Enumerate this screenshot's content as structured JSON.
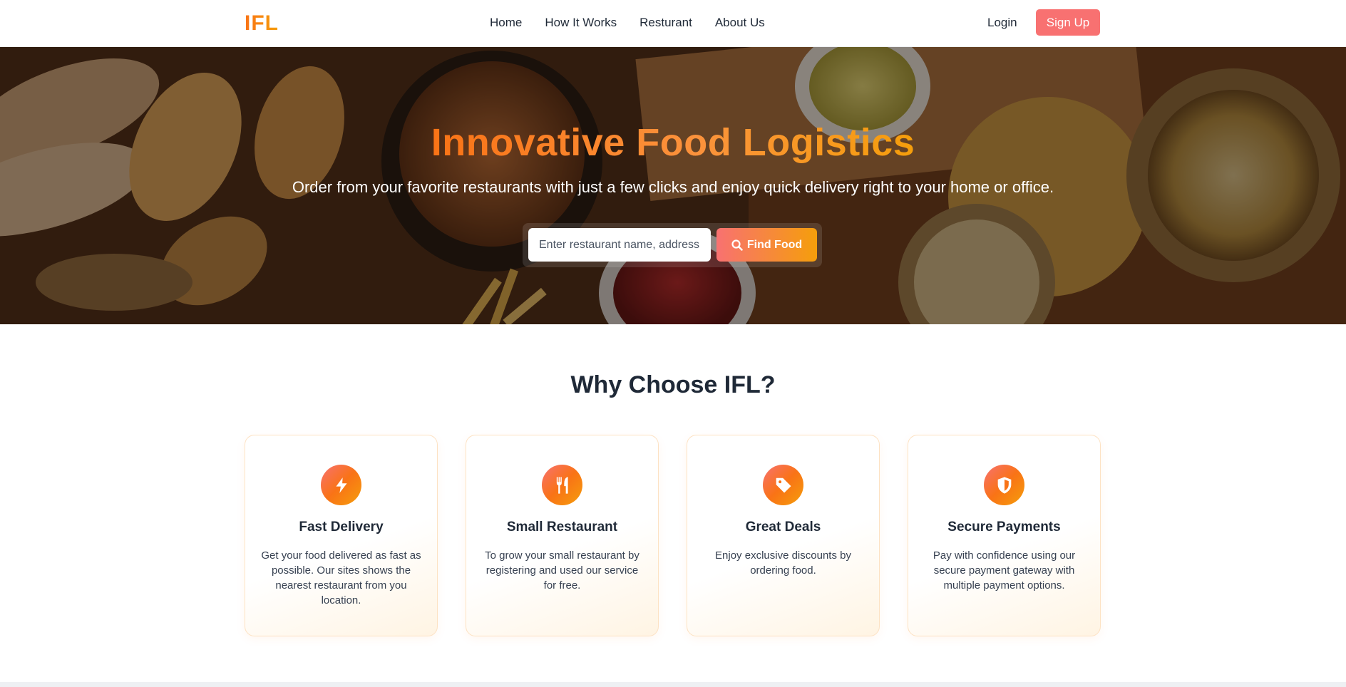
{
  "nav": {
    "logo": "IFL",
    "links": [
      "Home",
      "How It Works",
      "Resturant",
      "About Us"
    ],
    "login": "Login",
    "signup": "Sign Up"
  },
  "hero": {
    "title": "Innovative Food Logistics",
    "subtitle": "Order from your favorite restaurants with just a few clicks and enjoy quick delivery right to your home or office.",
    "search_placeholder": "Enter restaurant name, address",
    "search_button": "Find Food"
  },
  "features": {
    "title": "Why Choose IFL?",
    "cards": [
      {
        "icon": "lightning-icon",
        "title": "Fast Delivery",
        "text": "Get your food delivered as fast as possible. Our sites shows the nearest restaurant from you location."
      },
      {
        "icon": "utensils-icon",
        "title": "Small Restaurant",
        "text": "To grow your small restaurant by registering and used our service for free."
      },
      {
        "icon": "tag-icon",
        "title": "Great Deals",
        "text": "Enjoy exclusive discounts by ordering food."
      },
      {
        "icon": "shield-icon",
        "title": "Secure Payments",
        "text": "Pay with confidence using our secure payment gateway with multiple payment options."
      }
    ]
  },
  "colors": {
    "accent": "#f97316",
    "accent_secondary": "#f59e0b",
    "signup_bg": "#f87171"
  }
}
